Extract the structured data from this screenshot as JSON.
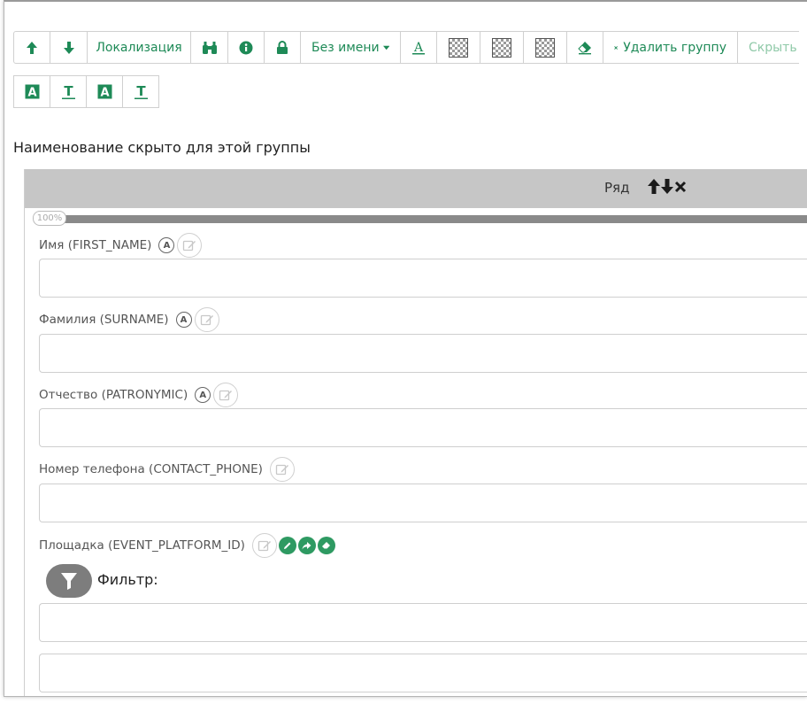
{
  "toolbar": {
    "localization_label": "Локализация",
    "noname_label": "Без имени",
    "delete_group_label": "Удалить группу",
    "hide_label": "Скрыть"
  },
  "group": {
    "hidden_name_text": "Наименование скрыто для этой группы"
  },
  "row": {
    "label": "Ряд",
    "width_percent": "100%"
  },
  "fields": [
    {
      "label": "Имя (FIRST_NAME)",
      "value": ""
    },
    {
      "label": "Фамилия (SURNAME)",
      "value": ""
    },
    {
      "label": "Отчество (PATRONYMIC)",
      "value": ""
    },
    {
      "label": "Номер телефона (CONTACT_PHONE)",
      "value": ""
    },
    {
      "label": "Площадка (EVENT_PLATFORM_ID)",
      "value": ""
    }
  ],
  "filter": {
    "label": "Фильтр:"
  },
  "colors": {
    "accent": "#1e8a57",
    "header_gray": "#c6c6c6",
    "progress": "#8a8a8a"
  }
}
